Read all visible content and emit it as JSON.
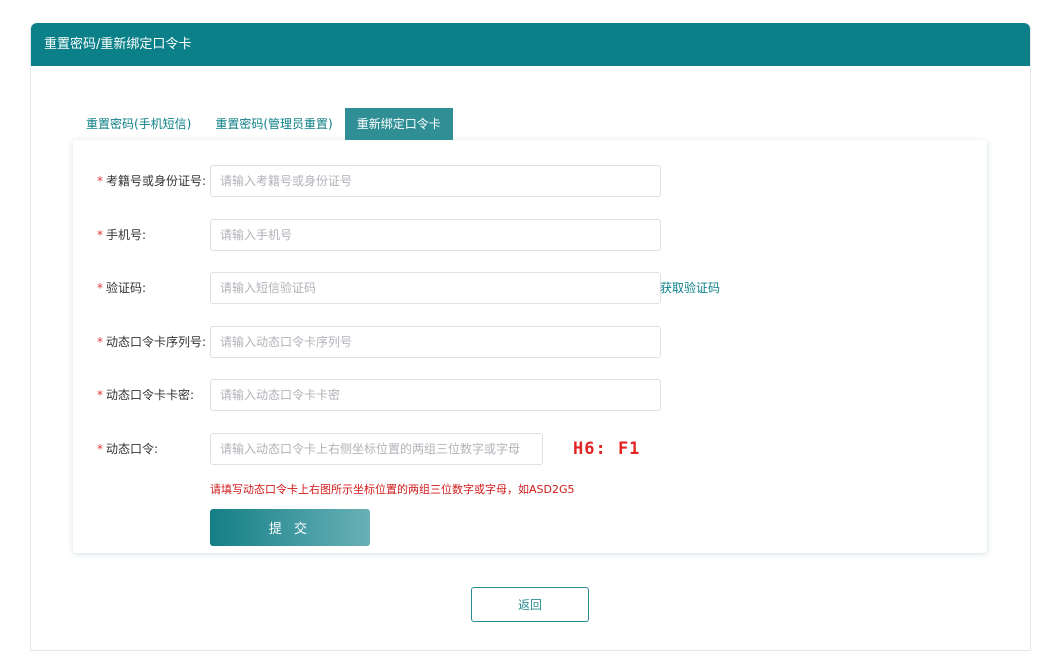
{
  "header": {
    "title": "重置密码/重新绑定口令卡"
  },
  "tabs": [
    {
      "label": "重置密码(手机短信)",
      "active": false
    },
    {
      "label": "重置密码(管理员重置)",
      "active": false
    },
    {
      "label": "重新绑定口令卡",
      "active": true
    }
  ],
  "form": {
    "required_mark": "*",
    "fields": [
      {
        "label": "考籍号或身份证号:",
        "placeholder": "请输入考籍号或身份证号",
        "value": ""
      },
      {
        "label": "手机号:",
        "placeholder": "请输入手机号",
        "value": ""
      },
      {
        "label": "验证码:",
        "placeholder": "请输入短信验证码",
        "value": "",
        "action": "获取验证码"
      },
      {
        "label": "动态口令卡序列号:",
        "placeholder": "请输入动态口令卡序列号",
        "value": ""
      },
      {
        "label": "动态口令卡卡密:",
        "placeholder": "请输入动态口令卡卡密",
        "value": ""
      },
      {
        "label": "动态口令:",
        "placeholder": "请输入动态口令卡上右侧坐标位置的两组三位数字或字母",
        "value": "",
        "coordinates": "H6: F1"
      }
    ],
    "hint": "请填写动态口令卡上右图所示坐标位置的两组三位数字或字母，如ASD2G5",
    "submit_label": "提 交"
  },
  "footer": {
    "back_label": "返回"
  },
  "colors": {
    "primary": "#0b8088",
    "danger": "#e12424"
  }
}
